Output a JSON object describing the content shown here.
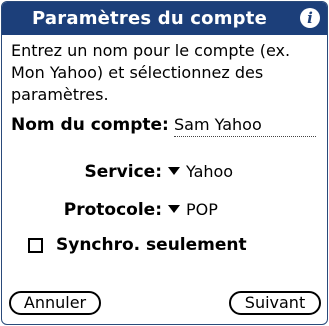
{
  "dialog": {
    "title": "Paramètres du compte",
    "info_icon": "info-icon",
    "instructions": "Entrez un nom pour le compte (ex. Mon Yahoo) et sélectionnez des paramètres.",
    "account_name": {
      "label": "Nom du compte:",
      "value": "Sam Yahoo"
    },
    "service": {
      "label": "Service:",
      "value": "Yahoo"
    },
    "protocol": {
      "label": "Protocole:",
      "value": "POP"
    },
    "sync_only": {
      "label": "Synchro. seulement",
      "checked": false
    },
    "buttons": {
      "cancel": "Annuler",
      "next": "Suivant"
    }
  },
  "colors": {
    "titlebar": "#1c3f7a",
    "background": "#ffffff",
    "text": "#000000"
  }
}
